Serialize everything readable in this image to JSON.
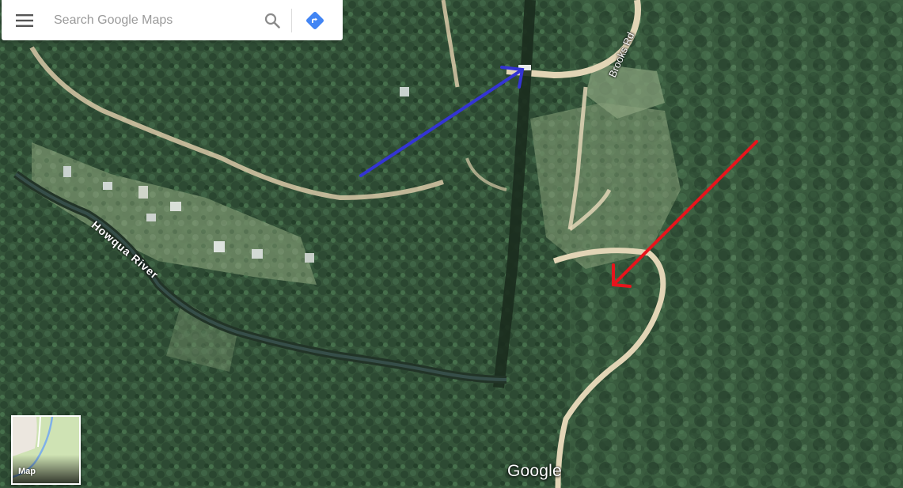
{
  "search": {
    "placeholder": "Search Google Maps"
  },
  "labels": {
    "road": "Brooks Rd",
    "river": "Howqua River"
  },
  "layer_toggle": {
    "label": "Map"
  },
  "branding": {
    "logo_text": "Google"
  },
  "colors": {
    "annotation_blue": "#3434d4",
    "annotation_red": "#e8141c",
    "directions_blue": "#4285f4"
  },
  "icons": [
    "menu-icon",
    "search-icon",
    "directions-icon"
  ]
}
